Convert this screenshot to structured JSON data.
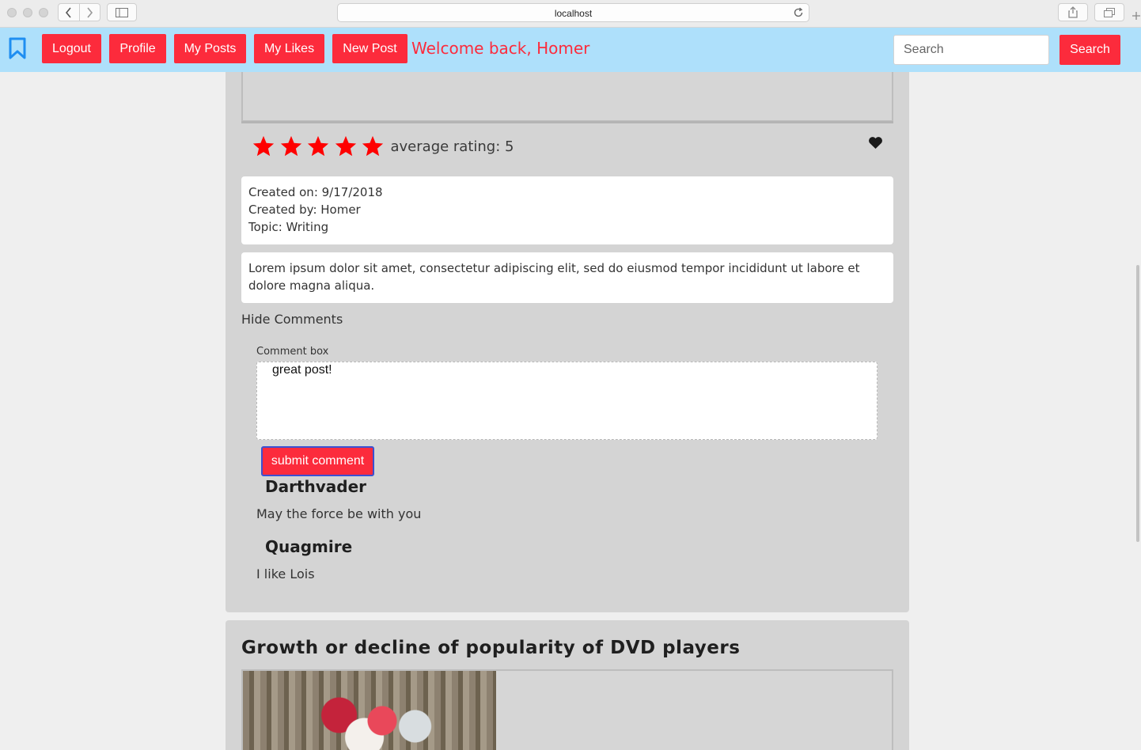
{
  "browser": {
    "url": "localhost"
  },
  "navbar": {
    "buttons": {
      "logout": "Logout",
      "profile": "Profile",
      "my_posts": "My Posts",
      "my_likes": "My Likes",
      "new_post": "New Post"
    },
    "welcome": "Welcome back, Homer",
    "search_placeholder": "Search",
    "search_button": "Search",
    "accent_color": "#fc2b3c",
    "bar_color": "#aee0fb"
  },
  "post": {
    "rating_stars": 5,
    "average_rating_label": "average rating: 5",
    "created_on": "Created on: 9/17/2018",
    "created_by": "Created by: Homer",
    "topic": "Topic: Writing",
    "description": "Lorem ipsum dolor sit amet, consectetur adipiscing elit, sed do eiusmod tempor incididunt ut labore et dolore magna aliqua.",
    "hide_comments": "Hide Comments",
    "comment_box_label": "Comment box",
    "comment_box_value": "great post!",
    "submit_label": "submit comment",
    "comments": [
      {
        "author": "Darthvader",
        "text": "May the force be with you"
      },
      {
        "author": "Quagmire",
        "text": "I like Lois"
      }
    ]
  },
  "next_post": {
    "title": "Growth or decline of popularity of DVD players"
  }
}
